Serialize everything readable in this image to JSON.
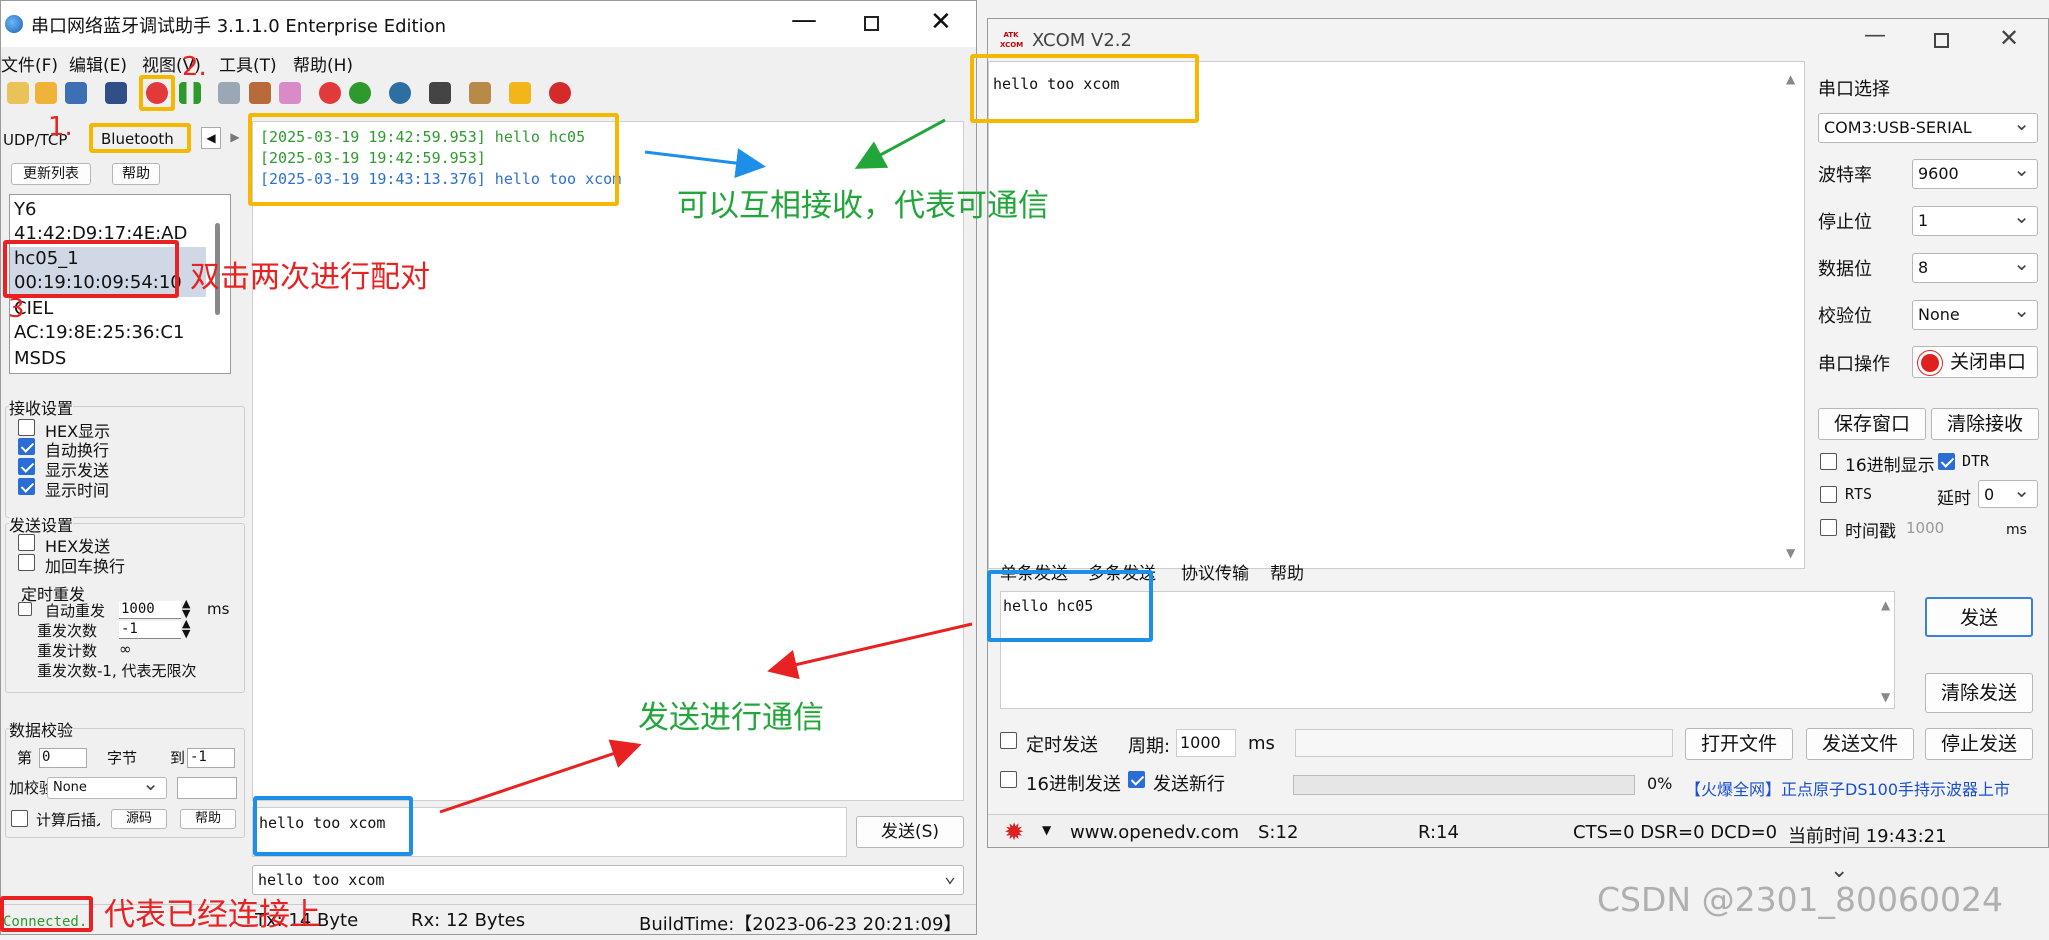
{
  "left_window": {
    "title": "串口网络蓝牙调试助手 3.1.1.0 Enterprise Edition",
    "menu": [
      "文件(F)",
      "编辑(E)",
      "视图(V)",
      "工具(T)",
      "帮助(H)"
    ],
    "tabs": {
      "udp": "UDP/TCP",
      "bluetooth": "Bluetooth"
    },
    "buttons": {
      "refresh": "更新列表",
      "help": "帮助"
    },
    "devices": [
      {
        "name": "Y6",
        "addr": "41:42:D9:17:4E:AD"
      },
      {
        "name": "hc05_1",
        "addr": "00:19:10:09:54:10"
      },
      {
        "name": "CIEL",
        "addr": "AC:19:8E:25:36:C1"
      },
      {
        "name": "MSDS",
        "addr": ""
      }
    ],
    "recv": {
      "title": "接收设置",
      "hex": "HEX显示",
      "autowrap": "自动换行",
      "showsend": "显示发送",
      "showtime": "显示时间"
    },
    "send": {
      "title": "发送设置",
      "hex": "HEX发送",
      "crlf": "加回车换行",
      "timer_title": "定时重发",
      "auto": "自动重发",
      "auto_val": "1000",
      "ms": "ms",
      "count_label": "重发次数",
      "count_val": "-1",
      "done_label": "重发计数",
      "done_val": "∞",
      "note": "重发次数-1, 代表无限次"
    },
    "check": {
      "title": "数据校验",
      "from_label": "第",
      "from_val": "0",
      "byte_label": "字节",
      "to_label": "到",
      "to_val": "-1",
      "add_label": "加校验",
      "add_val": "None",
      "after": "计算后插入",
      "src_btn": "源码",
      "help_btn": "帮助"
    },
    "log": [
      {
        "text": "[2025-03-19 19:42:59.953] hello hc05",
        "color": "#2e9a2e"
      },
      {
        "text": "[2025-03-19 19:42:59.953]",
        "color": "#2e9a2e"
      },
      {
        "text": "[2025-03-19 19:43:13.376] hello too xcom",
        "color": "#2d6fd6"
      }
    ],
    "send_text": "hello too xcom",
    "send_btn": "发送(S)",
    "history": "hello too xcom",
    "status": {
      "conn": "Connected.",
      "tx": "Tx: 14 Bytes",
      "rx": "Rx: 12 Bytes",
      "build": "BuildTime:【2023-06-23 20:21:09】"
    }
  },
  "right_window": {
    "title": "XCOM V2.2",
    "logo": "ATK XCOM",
    "recv_text": "hello too xcom",
    "port": {
      "label": "串口选择",
      "value": "COM3:USB-SERIAL"
    },
    "baud": {
      "label": "波特率",
      "value": "9600"
    },
    "stop": {
      "label": "停止位",
      "value": "1"
    },
    "data": {
      "label": "数据位",
      "value": "8"
    },
    "parity": {
      "label": "校验位",
      "value": "None"
    },
    "op": {
      "label": "串口操作",
      "button": "关闭串口"
    },
    "save_btn": "保存窗口",
    "clear_recv_btn": "清除接收",
    "hex_display": "16进制显示",
    "dtr": "DTR",
    "rts": "RTS",
    "delay_label": "延时",
    "delay_val": "0",
    "timestamp": "时间戳",
    "ts_val": "1000",
    "ts_unit": "ms",
    "tabs": [
      "单条发送",
      "多条发送",
      "协议传输",
      "帮助"
    ],
    "send_text": "hello hc05",
    "send_btn": "发送",
    "clear_send_btn": "清除发送",
    "timed_send": "定时发送",
    "period_label": "周期:",
    "period_val": "1000",
    "period_unit": "ms",
    "open_file": "打开文件",
    "send_file": "发送文件",
    "stop_send": "停止发送",
    "hex_send": "16进制发送",
    "newline": "发送新行",
    "percent": "0%",
    "ad": "【火爆全网】正点原子DS100手持示波器上市",
    "status": {
      "url": "www.openedv.com",
      "s": "S:12",
      "r": "R:14",
      "lines": "CTS=0 DSR=0 DCD=0",
      "time": "当前时间 19:43:21"
    }
  },
  "annotations": {
    "n1": "1.",
    "n2": "2.",
    "n3": "3",
    "pair": "双击两次进行配对",
    "mutual": "可以互相接收，代表可通信",
    "sendcomm": "发送进行通信",
    "connected": "代表已经连接上"
  },
  "watermark": "CSDN @2301_80060024",
  "colors": {
    "yellow": "#f5b800",
    "red": "#e82222",
    "blue": "#1e8fe8",
    "green": "#22a63a"
  }
}
